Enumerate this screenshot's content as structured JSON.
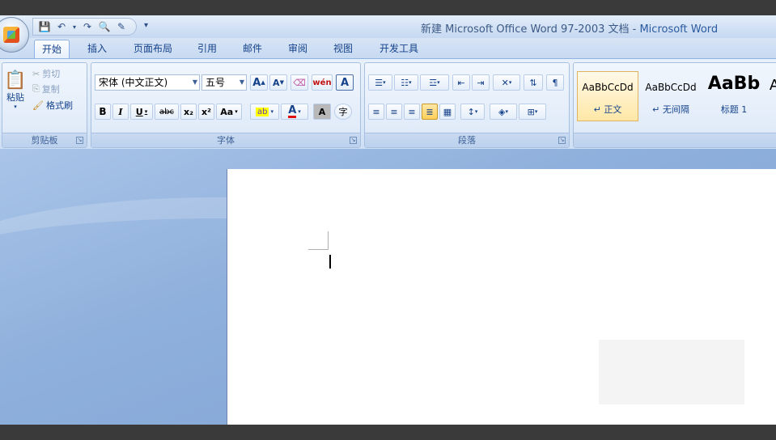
{
  "title": {
    "doc": "新建 Microsoft Office Word 97-2003 文档",
    "sep": " - ",
    "app": "Microsoft Word"
  },
  "tabs": [
    "开始",
    "插入",
    "页面布局",
    "引用",
    "邮件",
    "审阅",
    "视图",
    "开发工具"
  ],
  "active_tab": "开始",
  "clipboard": {
    "label": "剪贴板",
    "paste": "粘贴",
    "cut": "剪切",
    "copy": "复制",
    "format_painter": "格式刷"
  },
  "font": {
    "label": "字体",
    "font_name": "宋体 (中文正文)",
    "font_size": "五号",
    "grow": "A",
    "shrink": "A",
    "change_case": "Aa",
    "bold": "B",
    "italic": "I",
    "underline": "U",
    "strike": "abc",
    "subscript": "x₂",
    "superscript": "x²",
    "font_color": "A",
    "char_shading": "A",
    "enclose": "字",
    "phonetic": "wén",
    "border": "A"
  },
  "paragraph": {
    "label": "段落"
  },
  "styles": [
    {
      "sample": "AaBbCcDd",
      "name": "↵ 正文",
      "selected": true
    },
    {
      "sample": "AaBbCcDd",
      "name": "↵ 无间隔",
      "selected": false
    },
    {
      "sample": "AaBb",
      "name": "标题 1",
      "selected": false
    },
    {
      "sample": "A",
      "name": "",
      "selected": false
    }
  ],
  "colors": {
    "ribbon": "#dde9f8",
    "doc_bg": "#8fb0dc",
    "accent": "#15428b",
    "highlight": "#ffe7a6"
  },
  "icons": [
    "save-icon",
    "undo-icon",
    "redo-icon",
    "print-preview-icon",
    "edit-icon",
    "paste-icon",
    "cut-icon",
    "copy-icon",
    "format-painter-icon"
  ]
}
